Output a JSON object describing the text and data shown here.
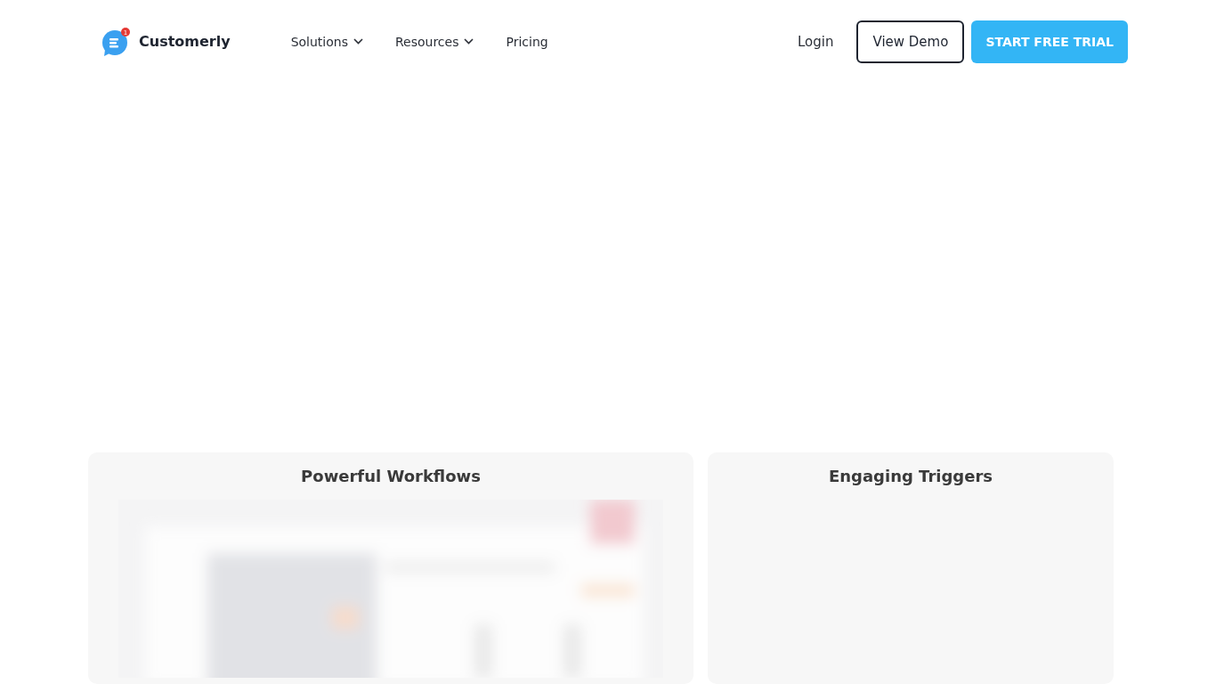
{
  "brand": {
    "name": "Customerly",
    "badge": "1"
  },
  "nav": [
    {
      "label": "Solutions",
      "dropdown": true
    },
    {
      "label": "Resources",
      "dropdown": true
    },
    {
      "label": "Pricing",
      "dropdown": false
    }
  ],
  "actions": {
    "login": "Login",
    "demo": "View Demo",
    "trial": "START FREE TRIAL"
  },
  "cards": [
    {
      "title": "Powerful Workflows",
      "kind": "picture"
    },
    {
      "title": "Engaging Triggers",
      "kind": "empty"
    }
  ]
}
